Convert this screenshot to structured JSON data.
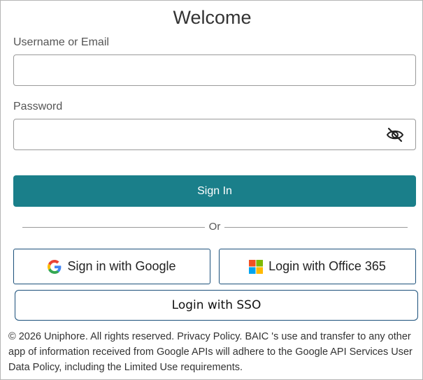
{
  "header": {
    "title": "Welcome"
  },
  "form": {
    "username_label": "Username or Email",
    "username_value": "",
    "password_label": "Password",
    "password_value": "",
    "password_toggle_icon": "eye-off-icon",
    "sign_in_label": "Sign In"
  },
  "divider": {
    "label": "Or"
  },
  "oauth": {
    "google_label": "Sign in with Google",
    "google_icon": "google-logo-icon",
    "office_label": "Login with Office 365",
    "office_icon": "microsoft-logo-icon",
    "sso_label": "Login with SSO"
  },
  "footer": {
    "copyright": "© 2026 Uniphore. All rights reserved.",
    "privacy_link": "Privacy Policy.",
    "notice": "BAIC 's use and transfer to any other app of information received from Google APIs will adhere to the Google API Services User Data Policy, including the Limited Use requirements."
  },
  "colors": {
    "primary": "#1a7f8a",
    "button_border": "#1a4f7a",
    "input_border": "#9a9a9a"
  }
}
